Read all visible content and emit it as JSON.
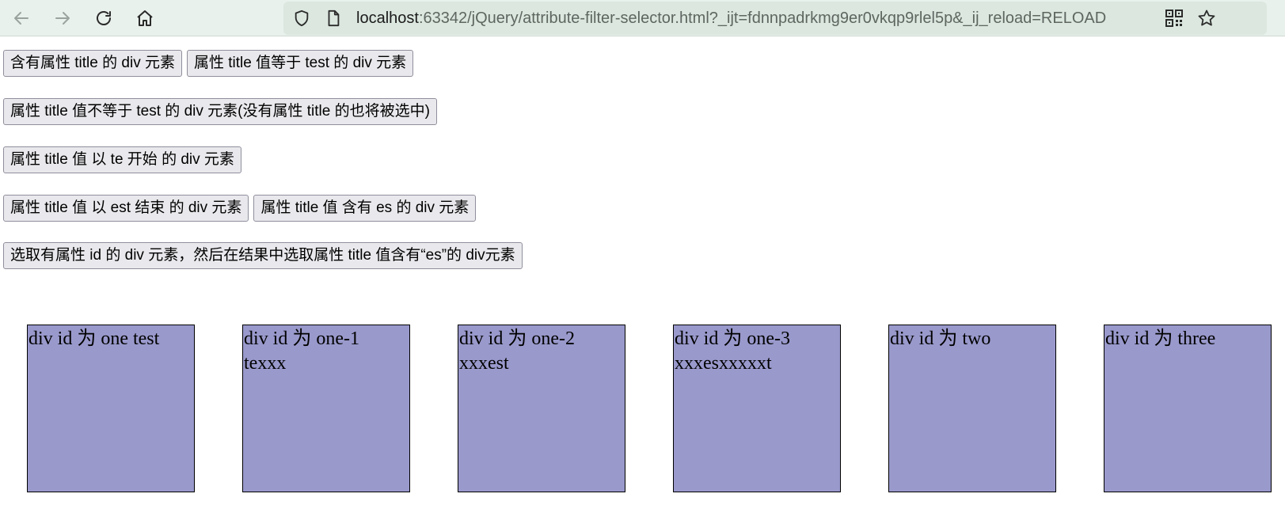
{
  "browser": {
    "url_host": "localhost",
    "url_rest": ":63342/jQuery/attribute-filter-selector.html?_ijt=fdnnpadrkmg9er0vkqp9rlel5p&_ij_reload=RELOAD"
  },
  "buttons": {
    "row1": [
      "含有属性 title 的 div 元素",
      "属性 title 值等于 test 的 div 元素"
    ],
    "row2": [
      "属性 title 值不等于 test 的 div 元素(没有属性 title 的也将被选中)"
    ],
    "row3": [
      "属性 title 值 以 te 开始 的 div 元素"
    ],
    "row4": [
      "属性 title 值 以 est 结束 的 div 元素",
      "属性 title 值 含有 es 的 div 元素"
    ],
    "row5": [
      "选取有属性 id 的 div 元素，然后在结果中选取属性 title 值含有“es”的 div元素"
    ]
  },
  "boxes": [
    {
      "line1": "div id 为 one test",
      "line2": ""
    },
    {
      "line1": "div id 为 one-1",
      "line2": "texxx"
    },
    {
      "line1": "div id 为 one-2",
      "line2": "xxxest"
    },
    {
      "line1": "div id 为 one-3",
      "line2": "xxxesxxxxxt"
    },
    {
      "line1": "div id 为 two",
      "line2": ""
    },
    {
      "line1": "div id 为 three",
      "line2": ""
    }
  ],
  "colors": {
    "box_bg": "#9999cc",
    "toolbar_bg": "#e9f1ec",
    "urlbar_bg": "#dbe7df"
  }
}
